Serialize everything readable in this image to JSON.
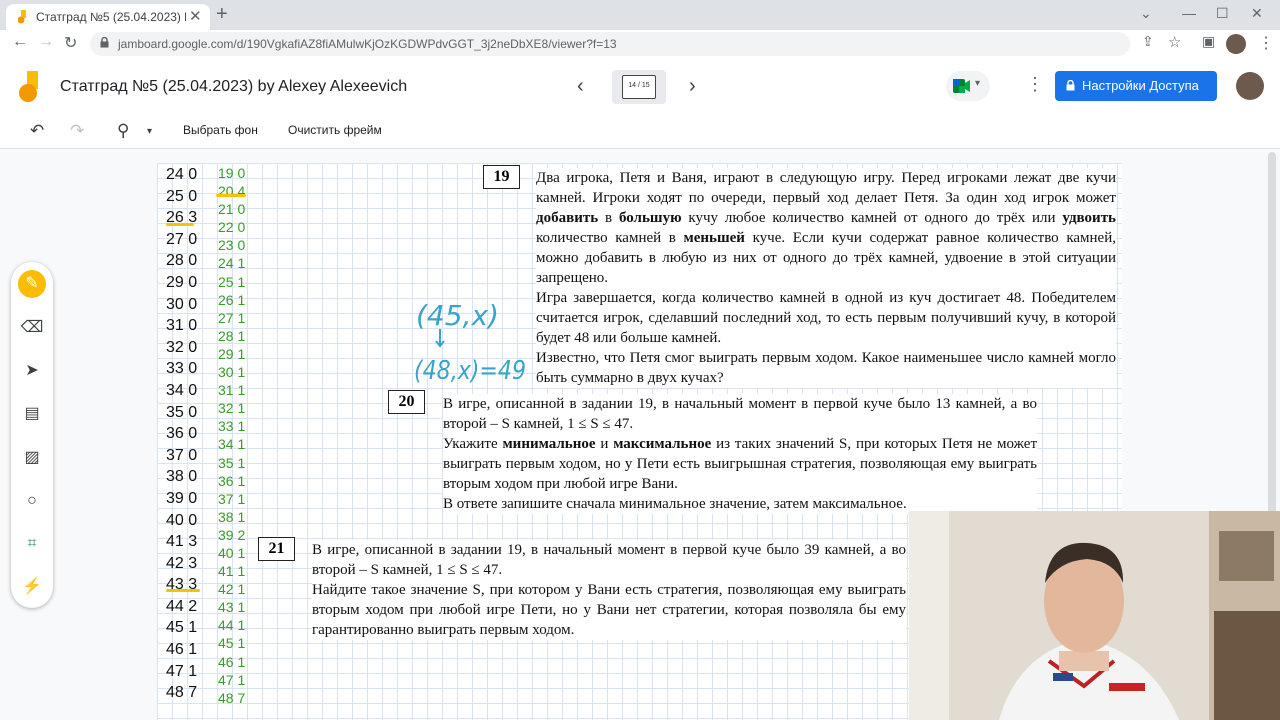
{
  "browser": {
    "tab_title": "Статград №5 (25.04.2023) by Ale",
    "url": "jamboard.google.com/d/190VgkafiAZ8fiAMulwKjOzKGDWPdvGGT_3j2neDbXE8/viewer?f=13"
  },
  "app": {
    "title": "Статград №5 (25.04.2023) by Alexey Alexeevich",
    "frame_counter": "14 / 15",
    "share_label": "Настройки Доступа"
  },
  "toolbar": {
    "set_background": "Выбрать фон",
    "clear_frame": "Очистить фрейм"
  },
  "table": {
    "col1": [
      "24 0",
      "25 0",
      "26 3",
      "27 0",
      "28 0",
      "29 0",
      "30 0",
      "31 0",
      "32 0",
      "33 0",
      "34 0",
      "35 0",
      "36 0",
      "37 0",
      "38 0",
      "39 0",
      "40 0",
      "41 3",
      "42 3",
      "43 3",
      "44 2",
      "45 1",
      "46 1",
      "47 1",
      "48 7"
    ],
    "col2": [
      "19 0",
      "20 4",
      "21 0",
      "22 0",
      "23 0",
      "24 1",
      "25 1",
      "26 1",
      "27 1",
      "28 1",
      "29 1",
      "30 1",
      "31 1",
      "32 1",
      "33 1",
      "34 1",
      "35 1",
      "36 1",
      "37 1",
      "38 1",
      "39 2",
      "40 1",
      "41 1",
      "42 1",
      "43 1",
      "44 1",
      "45 1",
      "46 1",
      "47 1",
      "48 7"
    ]
  },
  "handwriting": {
    "line1": "(45,x)",
    "line2": "(48,x)=49"
  },
  "task19": {
    "number": "19",
    "p1_a": "Два игрока, Петя и Ваня, играют в следующую игру. Перед игроками лежат две кучи камней. Игроки ходят по очереди, первый ход делает Петя. За один ход игрок может ",
    "p1_b1": "добавить",
    "p1_c": " в ",
    "p1_b2": "большую",
    "p1_d": " кучу любое количество камней от одного до трёх или ",
    "p1_b3": "удвоить",
    "p1_e": " количество камней в ",
    "p1_b4": "меньшей",
    "p1_f": " куче. Если кучи содержат равное количество камней, можно добавить в любую из них от одного до трёх камней, удвоение в этой ситуации запрещено.",
    "p2": "Игра завершается, когда количество камней в одной из куч достигает 48. Победителем считается игрок, сделавший последний ход, то есть первым получивший кучу, в которой будет 48 или больше камней.",
    "p3": "Известно, что Петя смог выиграть первым ходом. Какое наименьшее число камней могло быть суммарно в двух кучах?"
  },
  "task20": {
    "number": "20",
    "p1": "В игре, описанной в задании 19, в начальный момент в первой куче было 13 камней, а во второй – S камней, 1 ≤ S ≤ 47.",
    "p2_a": "Укажите ",
    "p2_b1": "минимальное",
    "p2_c": " и ",
    "p2_b2": "максимальное",
    "p2_d": " из таких значений S, при которых Петя не может выиграть первым ходом, но у Пети есть выигрышная стратегия, позволяющая ему выиграть вторым ходом при любой игре Вани.",
    "p3": "В ответе запишите сначала минимальное значение, затем максимальное."
  },
  "task21": {
    "number": "21",
    "p1": "В игре, описанной в задании 19, в начальный момент в первой куче было 39 камней, а во второй – S камней, 1 ≤ S ≤ 47.",
    "p2": "Найдите такое значение S, при котором у Вани есть стратегия, позволяющая ему выиграть вторым ходом при любой игре Пети, но у Вани нет стратегии, которая позволяла бы ему гарантированно выиграть первым ходом."
  },
  "colors": {
    "accent": "#1a73e8",
    "pen": "#fbbc04",
    "highlight": "#f2c500",
    "green_column": "#3a9a2a",
    "handwriting": "#3aa3c9"
  }
}
